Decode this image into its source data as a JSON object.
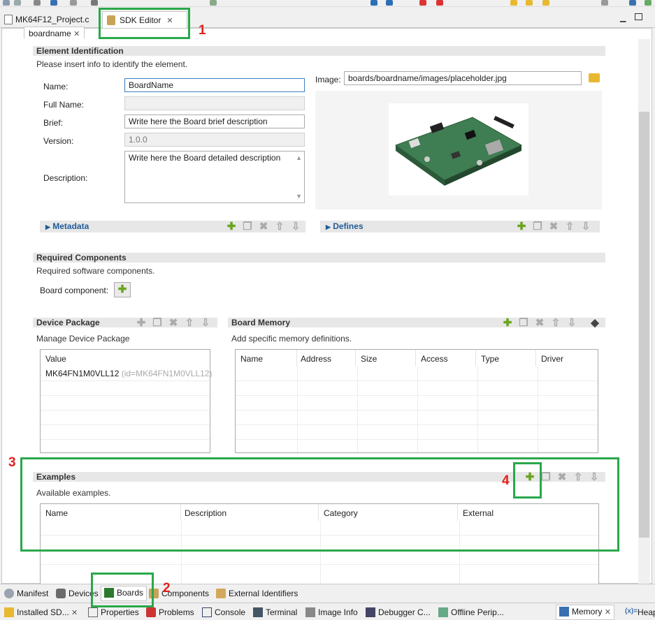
{
  "tabs": {
    "file_tab": "MK64F12_Project.c",
    "sdk_tab": "SDK Editor",
    "sub_tab": "boardname"
  },
  "element_identification": {
    "title": "Element Identification",
    "desc": "Please insert info to identify the element.",
    "name_label": "Name:",
    "name_value": "BoardName",
    "fullname_label": "Full Name:",
    "fullname_value": "",
    "brief_label": "Brief:",
    "brief_value": "Write here the Board brief description",
    "version_label": "Version:",
    "version_value": "1.0.0",
    "description_label": "Description:",
    "description_value": "Write here the Board detailed description",
    "image_label": "Image:",
    "image_value": "boards/boardname/images/placeholder.jpg",
    "metadata": "Metadata",
    "defines": "Defines"
  },
  "required_components": {
    "title": "Required Components",
    "desc": "Required software components.",
    "board_component_label": "Board component:"
  },
  "device_package": {
    "title": "Device Package",
    "desc": "Manage Device Package",
    "column": "Value",
    "value": "MK64FN1M0VLL12",
    "id": "(id=MK64FN1M0VLL12)"
  },
  "board_memory": {
    "title": "Board Memory",
    "desc": "Add specific memory definitions.",
    "columns": [
      "Name",
      "Address",
      "Size",
      "Access",
      "Type",
      "Driver"
    ]
  },
  "examples": {
    "title": "Examples",
    "desc": "Available examples.",
    "columns": [
      "Name",
      "Description",
      "Category",
      "External"
    ]
  },
  "editor_tabs": [
    "Manifest",
    "Devices",
    "Boards",
    "Components",
    "External Identifiers"
  ],
  "bottom_tabs": [
    "Installed SD...",
    "Properties",
    "Problems",
    "Console",
    "Terminal",
    "Image Info",
    "Debugger C...",
    "Offline Perip...",
    "Memory",
    "Heap"
  ],
  "callouts": [
    "1",
    "2",
    "3",
    "4"
  ],
  "colors": {
    "highlight": "#2aa84a",
    "callout": "#e02020",
    "accent": "#1f5c99",
    "add_icon": "#6aa420"
  }
}
